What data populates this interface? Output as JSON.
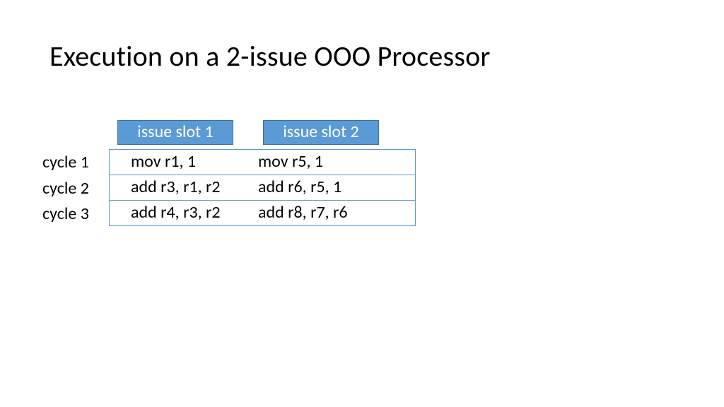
{
  "title": "Execution on a 2-issue OOO Processor",
  "headers": {
    "slot1": "issue slot 1",
    "slot2": "issue slot 2"
  },
  "rows": [
    {
      "label": "cycle 1",
      "slot1": "mov r1, 1",
      "slot2": "mov r5, 1"
    },
    {
      "label": "cycle 2",
      "slot1": "add r3, r1, r2",
      "slot2": "add r6, r5, 1"
    },
    {
      "label": "cycle 3",
      "slot1": "add r4, r3, r2",
      "slot2": "add r8, r7, r6"
    }
  ]
}
